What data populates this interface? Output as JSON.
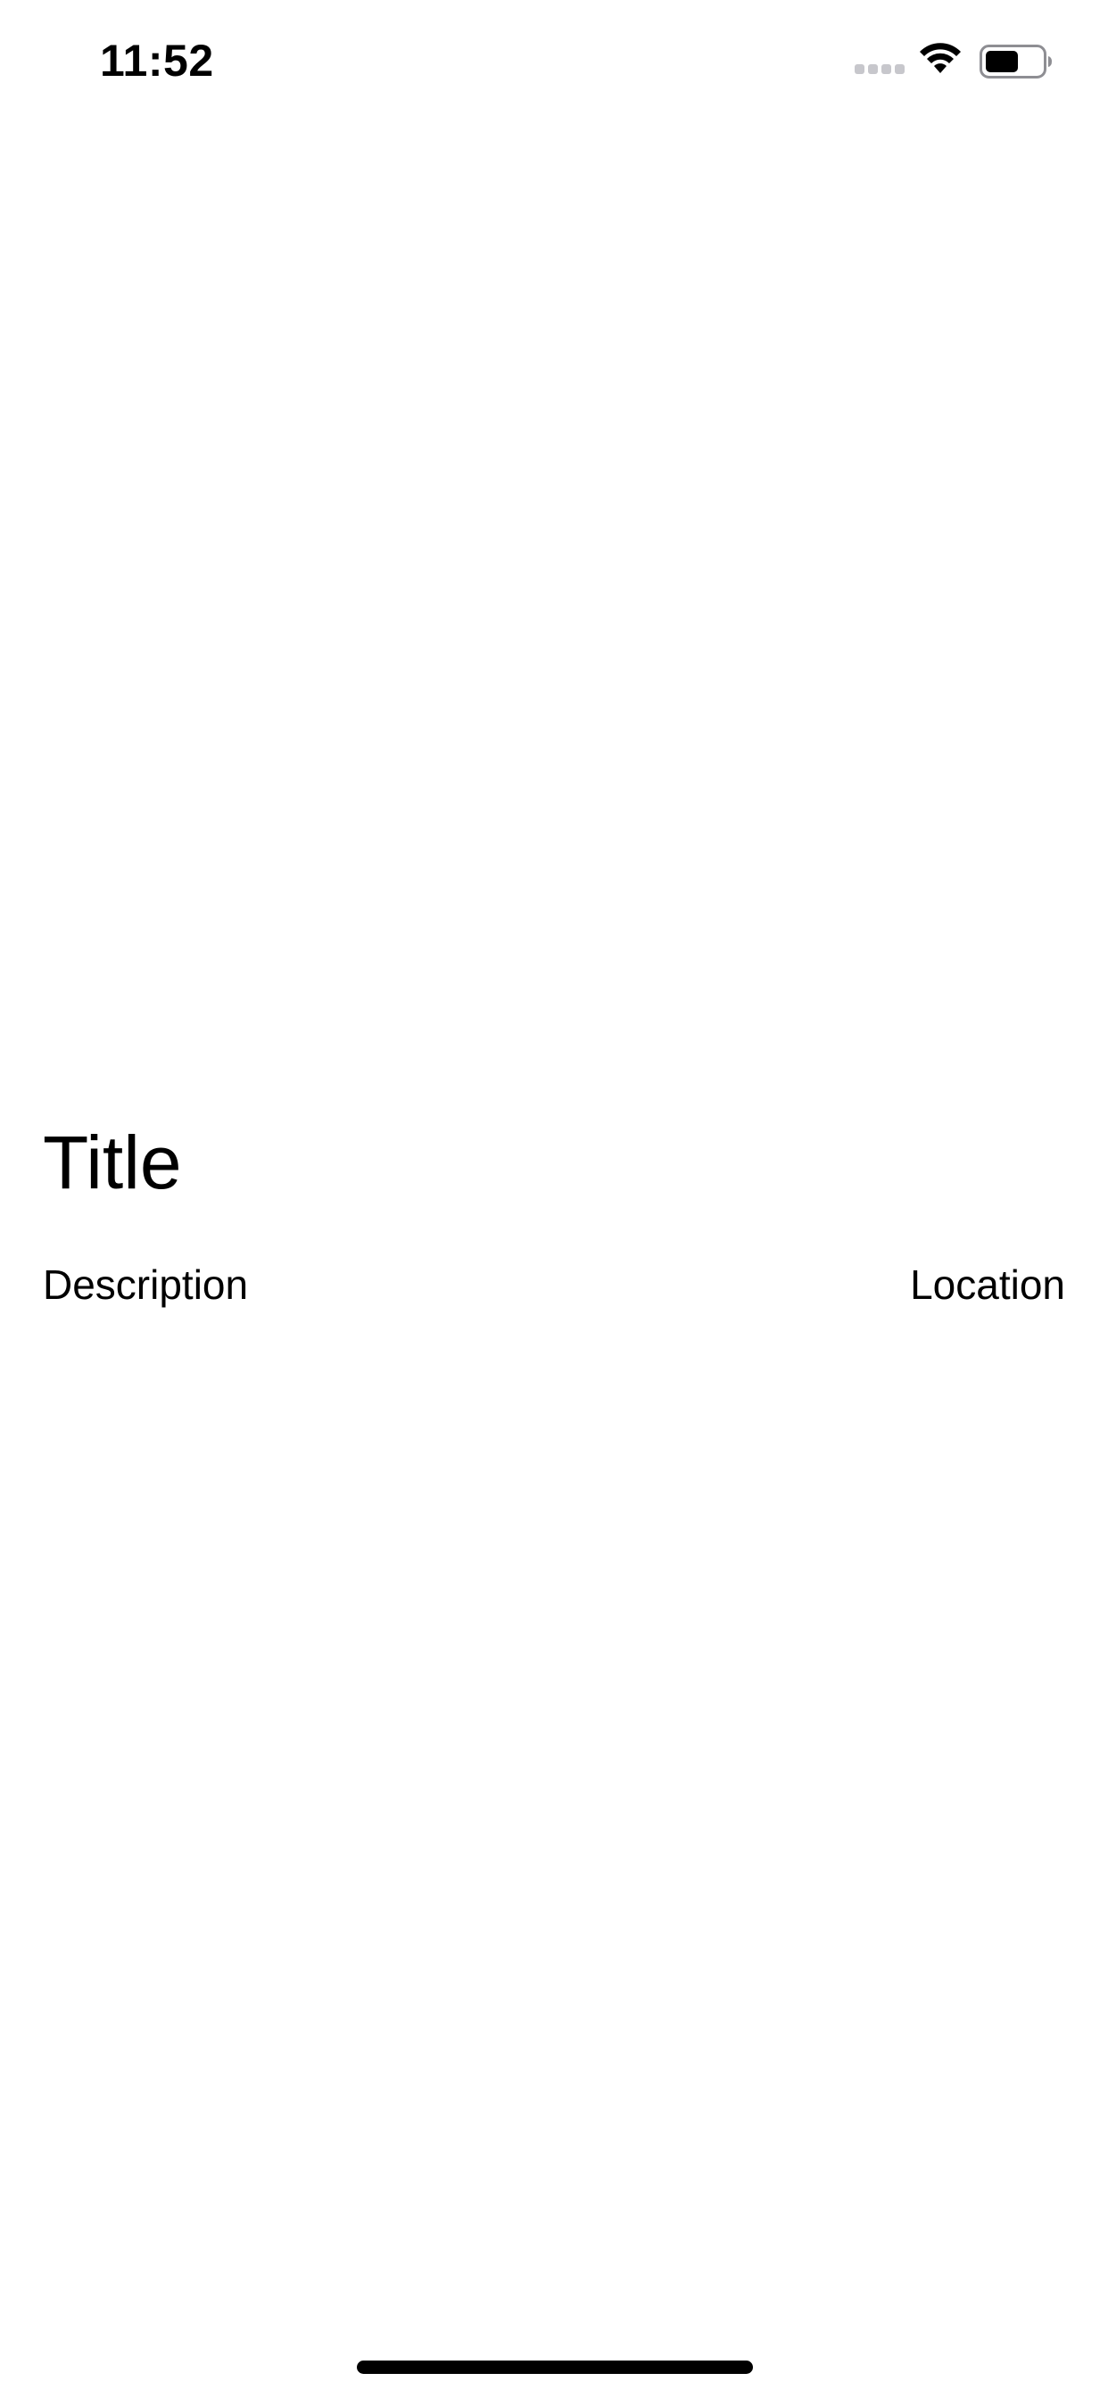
{
  "status_bar": {
    "time": "11:52",
    "icons": [
      "signal-icon",
      "wifi-icon",
      "battery-icon"
    ]
  },
  "main": {
    "title": "Title",
    "description": "Description",
    "location": "Location"
  },
  "colors": {
    "background": "#ffffff",
    "text": "#000000",
    "signal_inactive": "#c7c7cc"
  }
}
